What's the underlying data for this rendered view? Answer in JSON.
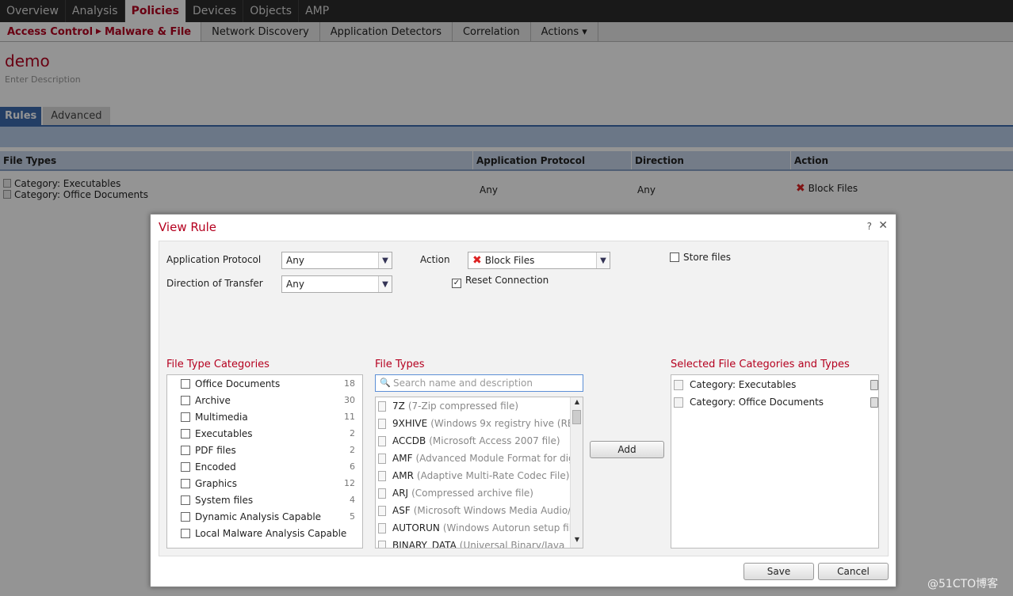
{
  "topnav": {
    "items": [
      "Overview",
      "Analysis",
      "Policies",
      "Devices",
      "Objects",
      "AMP"
    ],
    "active": "Policies"
  },
  "subnav": {
    "crumb_parent": "Access Control",
    "crumb_current": "Malware & File",
    "tabs": [
      "Network Discovery",
      "Application Detectors",
      "Correlation",
      "Actions ▾"
    ]
  },
  "policy": {
    "title": "demo",
    "description": "Enter Description"
  },
  "rule_tabs": [
    "Rules",
    "Advanced"
  ],
  "table": {
    "headers": [
      "File Types",
      "Application Protocol",
      "Direction",
      "Action"
    ],
    "row": {
      "file_types": [
        "Category: Executables",
        "Category: Office Documents"
      ],
      "protocol": "Any",
      "direction": "Any",
      "action": "Block Files"
    }
  },
  "dialog": {
    "title": "View Rule",
    "help": "?",
    "close": "✕",
    "app_protocol_label": "Application Protocol",
    "app_protocol_value": "Any",
    "direction_label": "Direction of Transfer",
    "direction_value": "Any",
    "action_label": "Action",
    "action_value": "Block Files",
    "reset_connection_label": "Reset Connection",
    "reset_connection_checked": true,
    "store_files_label": "Store files",
    "store_files_checked": false,
    "categories_heading": "File Type Categories",
    "categories": [
      {
        "name": "Office Documents",
        "count": "18"
      },
      {
        "name": "Archive",
        "count": "30"
      },
      {
        "name": "Multimedia",
        "count": "11"
      },
      {
        "name": "Executables",
        "count": "2"
      },
      {
        "name": "PDF files",
        "count": "2"
      },
      {
        "name": "Encoded",
        "count": "6"
      },
      {
        "name": "Graphics",
        "count": "12"
      },
      {
        "name": "System files",
        "count": "4"
      },
      {
        "name": "Dynamic Analysis Capable",
        "count": "5"
      },
      {
        "name": "Local Malware Analysis Capable",
        "count": ""
      }
    ],
    "types_heading": "File Types",
    "search_placeholder": "Search name and description",
    "file_types": [
      {
        "name": "7Z",
        "desc": "(7-Zip compressed file)"
      },
      {
        "name": "9XHIVE",
        "desc": "(Windows 9x registry hive (RE"
      },
      {
        "name": "ACCDB",
        "desc": "(Microsoft Access 2007 file)"
      },
      {
        "name": "AMF",
        "desc": "(Advanced Module Format for digi"
      },
      {
        "name": "AMR",
        "desc": "(Adaptive Multi-Rate Codec File)"
      },
      {
        "name": "ARJ",
        "desc": "(Compressed archive file)"
      },
      {
        "name": "ASF",
        "desc": "(Microsoft Windows Media Audio/V"
      },
      {
        "name": "AUTORUN",
        "desc": "(Windows Autorun setup file"
      },
      {
        "name": "BINARY_DATA",
        "desc": "(Universal Binary/Java"
      }
    ],
    "add_label": "Add",
    "selected_heading": "Selected File Categories and Types",
    "selected": [
      "Category: Executables",
      "Category: Office Documents"
    ],
    "save_label": "Save",
    "cancel_label": "Cancel"
  },
  "watermark": "@51CTO博客"
}
